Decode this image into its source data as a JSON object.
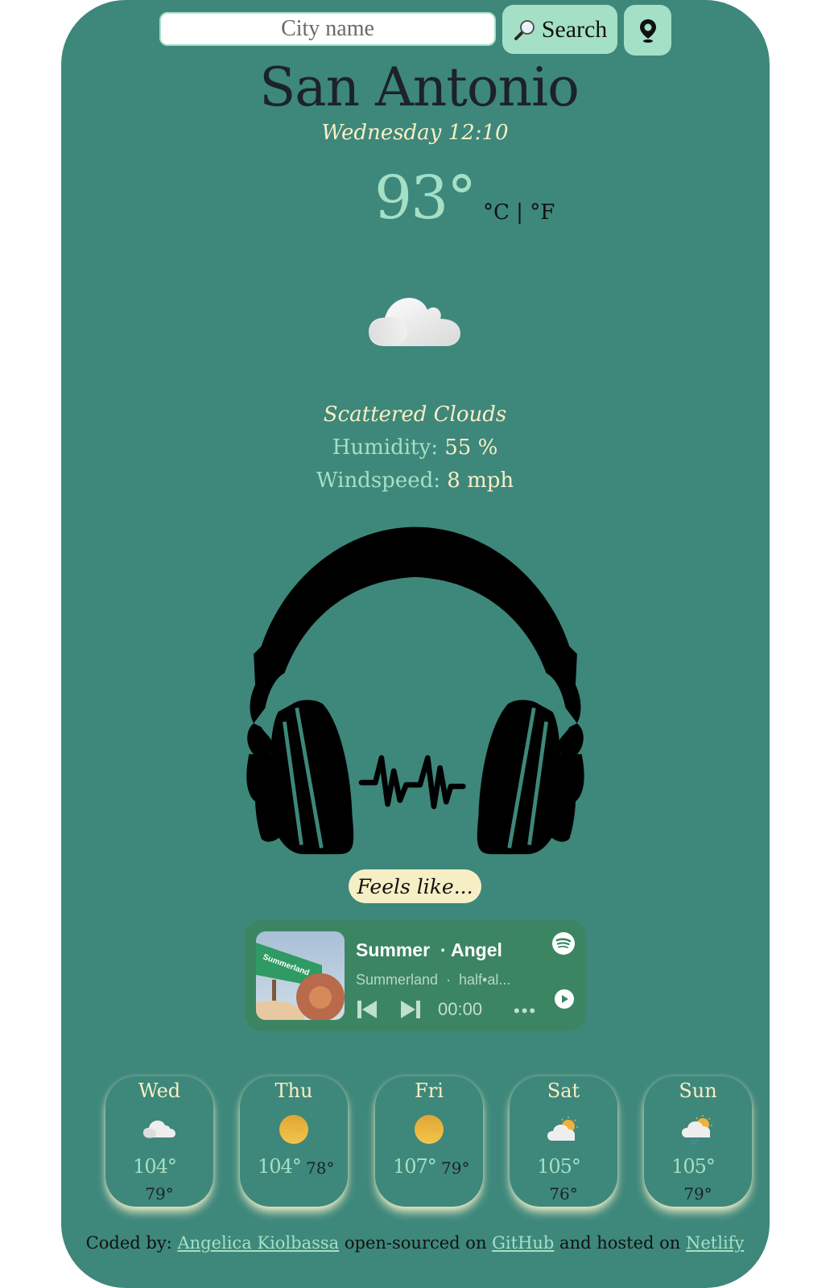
{
  "search": {
    "placeholder": "City name",
    "button_label": "Search",
    "search_icon": "magnifier-icon",
    "location_icon": "map-pin-icon"
  },
  "current": {
    "city": "San Antonio",
    "datetime": "Wednesday 12:10",
    "temperature": "93°",
    "unit_celsius": "°C",
    "unit_separator": " | ",
    "unit_fahrenheit": "°F",
    "icon": "cloud-icon",
    "description": "Scattered Clouds",
    "humidity_label": "Humidity:",
    "humidity_value": "55 %",
    "wind_label": "Windspeed:",
    "wind_value": "8 mph"
  },
  "feels_like": {
    "label": "Feels like..."
  },
  "player": {
    "track": "Summer  · Angel",
    "artist": "Summerland  ·  half•al...",
    "time": "00:00",
    "more": "•••",
    "cover_sign_text": "Summerland"
  },
  "forecast": [
    {
      "day": "Wed",
      "icon": "cloud",
      "high": "104°",
      "low": "79°"
    },
    {
      "day": "Thu",
      "icon": "sun",
      "high": "104°",
      "low": "78°"
    },
    {
      "day": "Fri",
      "icon": "sun",
      "high": "107°",
      "low": "79°"
    },
    {
      "day": "Sat",
      "icon": "partly-cloudy",
      "high": "105°",
      "low": "76°"
    },
    {
      "day": "Sun",
      "icon": "partly-cloudy-rain",
      "high": "105°",
      "low": "79°"
    }
  ],
  "footer": {
    "prefix": "Coded by: ",
    "author": "Angelica Kiolbassa",
    "mid1": " open-sourced on ",
    "repo": "GitHub",
    "mid2": " and hosted on ",
    "host": "Netlify"
  },
  "colors": {
    "background": "#3e877b",
    "accent_mint": "#a4e0c6",
    "accent_cream": "#f7efc4",
    "player_bg": "#3b8563"
  }
}
